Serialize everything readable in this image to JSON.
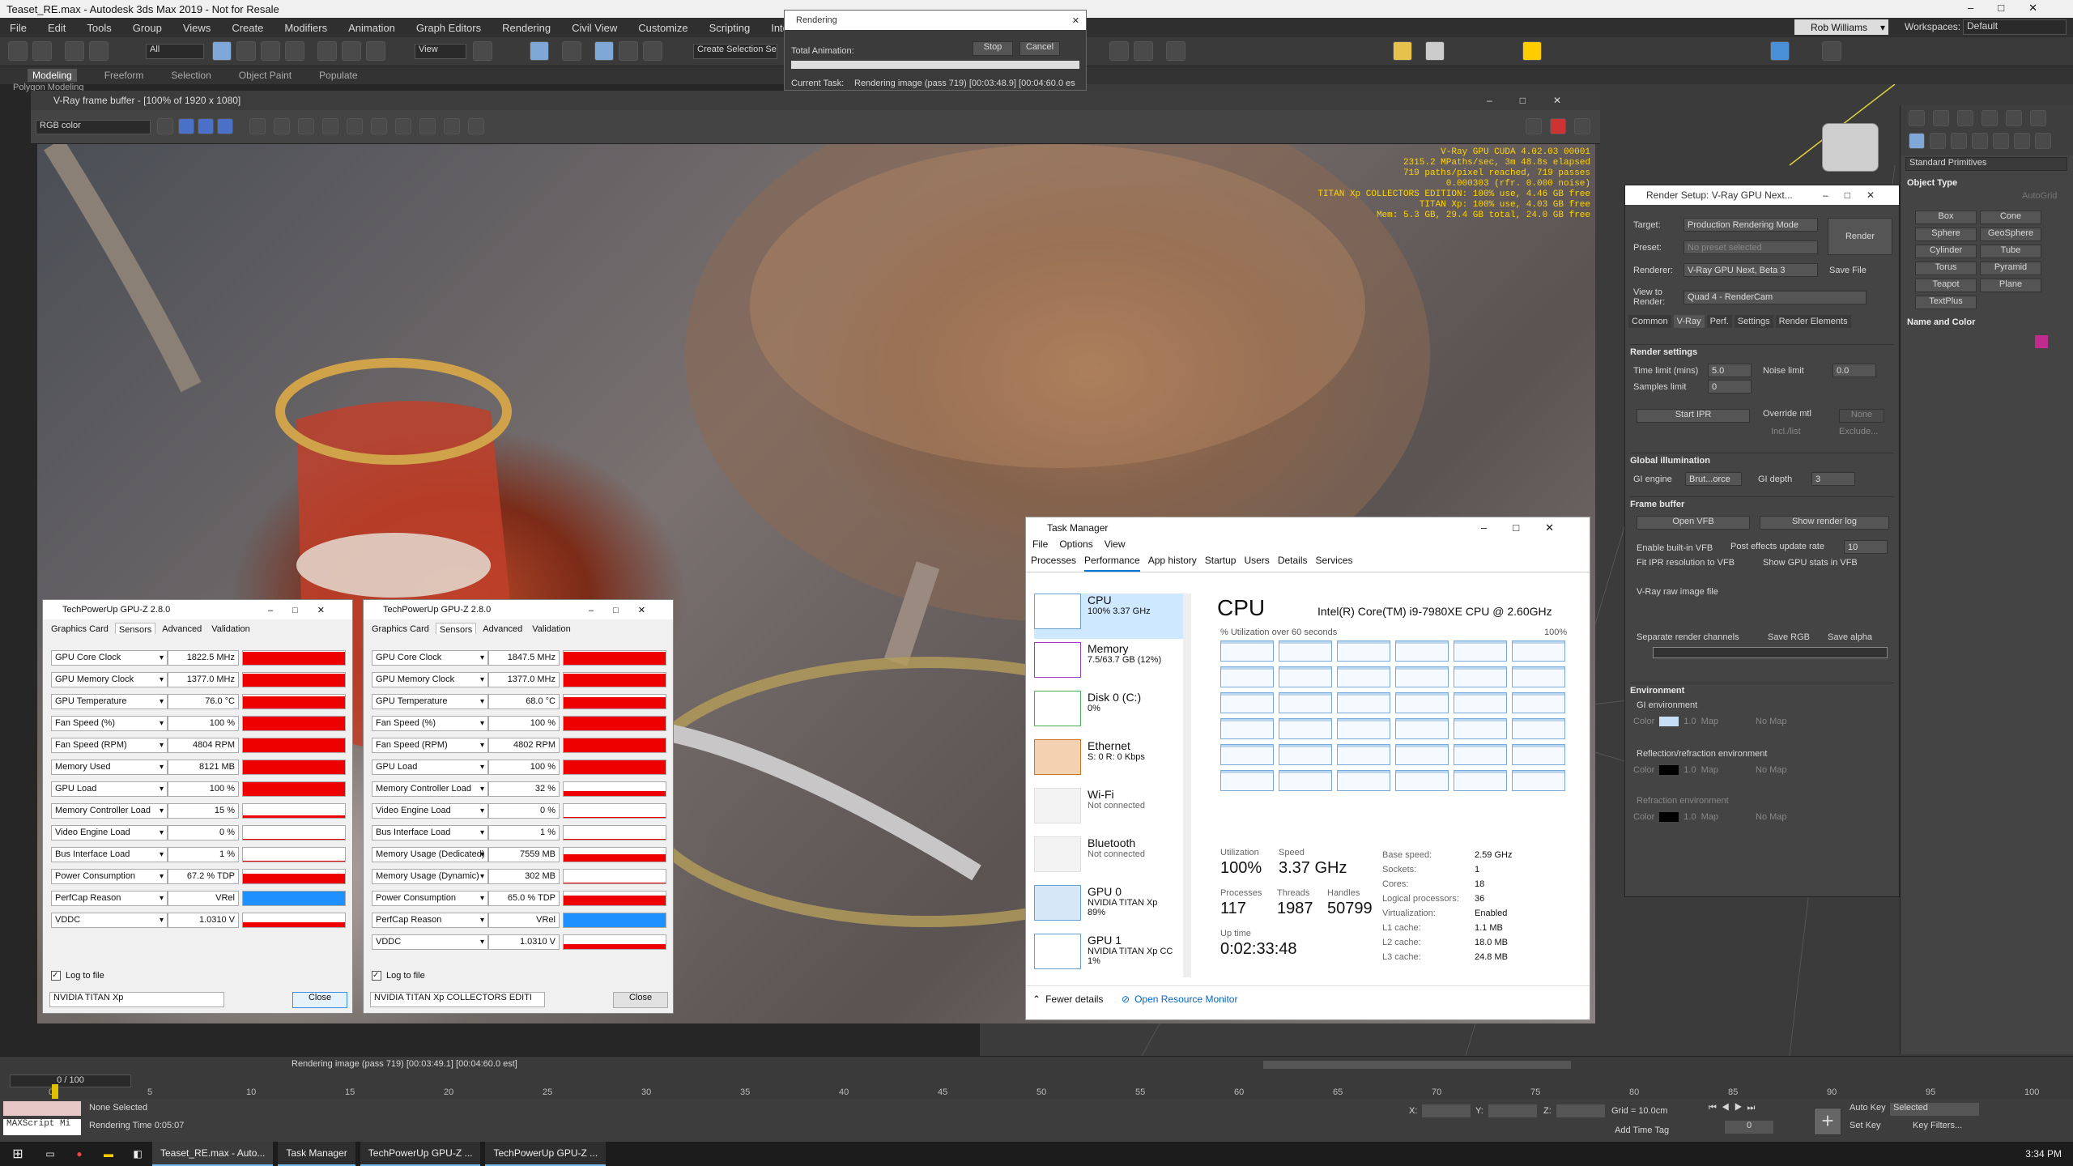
{
  "app": {
    "title": "Teaset_RE.max - Autodesk 3ds Max 2019 - Not for Resale",
    "user": "Rob Williams",
    "workspaces_label": "Workspaces:",
    "workspace": "Default"
  },
  "menu": [
    "File",
    "Edit",
    "Tools",
    "Group",
    "Views",
    "Create",
    "Modifiers",
    "Animation",
    "Graph Editors",
    "Rendering",
    "Civil View",
    "Customize",
    "Scripting",
    "Interactive"
  ],
  "toolbar": {
    "filter": "All",
    "view": "View",
    "selection_set": "Create Selection Se"
  },
  "ribbon": [
    "Modeling",
    "Freeform",
    "Selection",
    "Object Paint",
    "Populate"
  ],
  "ribbon_sub": "Polygon Modeling",
  "rendering_dialog": {
    "title": "Rendering",
    "stop": "Stop",
    "cancel": "Cancel",
    "total_label": "Total Animation:",
    "current_label": "Current Task:",
    "current_value": "Rendering image (pass 719) [00:03:48.9] [00:04:60.0 es"
  },
  "vfb": {
    "title": "V-Ray frame buffer - [100% of 1920 x 1080]",
    "channel": "RGB color",
    "stats": [
      "V-Ray GPU CUDA 4.02.03 00001",
      "2315.2 MPaths/sec, 3m 48.8s elapsed",
      "719 paths/pixel reached, 719 passes",
      "0.000303 (rfr. 0.000 noise)",
      "TITAN Xp COLLECTORS EDITION: 100% use, 4.46 GB free",
      "TITAN Xp: 100% use, 4.03 GB free",
      "Mem: 5.3 GB, 29.4 GB total, 24.0 GB free"
    ]
  },
  "render_setup": {
    "title": "Render Setup: V-Ray GPU Next...",
    "target_label": "Target:",
    "target": "Production Rendering Mode",
    "preset_label": "Preset:",
    "preset": "No preset selected",
    "renderer_label": "Renderer:",
    "renderer": "V-Ray GPU Next, Beta 3",
    "save_file": "Save File",
    "view_label": "View to Render:",
    "view": "Quad 4 - RenderCam",
    "render_btn": "Render",
    "tabs": [
      "Common",
      "V-Ray",
      "Perf.",
      "Settings",
      "Render Elements"
    ],
    "render_settings": "Render settings",
    "time_limit_label": "Time limit (mins)",
    "time_limit": "5.0",
    "noise_limit_label": "Noise limit",
    "noise_limit": "0.0",
    "samples_label": "Samples limit",
    "samples": "0",
    "start_ipr": "Start IPR",
    "override_mtl": "Override mtl",
    "none": "None",
    "incl_list": "Incl./list",
    "exclude": "Exclude...",
    "gi_section": "Global illumination",
    "gi_engine_label": "GI engine",
    "gi_engine": "Brut...orce",
    "gi_depth_label": "GI depth",
    "gi_depth": "3",
    "fb_section": "Frame buffer",
    "open_vfb": "Open VFB",
    "show_log": "Show render log",
    "enable_vfb": "Enable built-in VFB",
    "post_rate_label": "Post effects update rate",
    "post_rate": "10",
    "fit_ipr": "Fit IPR resolution to VFB",
    "gpu_stats": "Show GPU stats in VFB",
    "raw_file": "V-Ray raw image file",
    "sep_channels": "Separate render channels",
    "save_rgb": "Save RGB",
    "save_alpha": "Save alpha",
    "env_section": "Environment",
    "gi_env": "GI environment",
    "color": "Color",
    "env_val": "1.0",
    "map": "Map",
    "no_map": "No Map",
    "refl_env": "Reflection/refraction environment",
    "refr_env": "Refraction environment"
  },
  "command_panel": {
    "category": "Standard Primitives",
    "object_type": "Object Type",
    "autogrid": "AutoGrid",
    "buttons": [
      "Box",
      "Cone",
      "Sphere",
      "GeoSphere",
      "Cylinder",
      "Tube",
      "Torus",
      "Pyramid",
      "Teapot",
      "Plane",
      "TextPlus"
    ],
    "name_color": "Name and Color"
  },
  "task_manager": {
    "title": "Task Manager",
    "menu": [
      "File",
      "Options",
      "View"
    ],
    "tabs": [
      "Processes",
      "Performance",
      "App history",
      "Startup",
      "Users",
      "Details",
      "Services"
    ],
    "side": [
      {
        "name": "CPU",
        "sub": "100% 3.37 GHz"
      },
      {
        "name": "Memory",
        "sub": "7.5/63.7 GB (12%)"
      },
      {
        "name": "Disk 0 (C:)",
        "sub": "0%"
      },
      {
        "name": "Ethernet",
        "sub": "S: 0 R: 0 Kbps"
      },
      {
        "name": "Wi-Fi",
        "sub": "Not connected"
      },
      {
        "name": "Bluetooth",
        "sub": "Not connected"
      },
      {
        "name": "GPU 0",
        "sub": "NVIDIA TITAN Xp",
        "sub2": "89%"
      },
      {
        "name": "GPU 1",
        "sub": "NVIDIA TITAN Xp CC",
        "sub2": "1%"
      }
    ],
    "cpu_header": "CPU",
    "cpu_model": "Intel(R) Core(TM) i9-7980XE CPU @ 2.60GHz",
    "util_label": "% Utilization over 60 seconds",
    "pct100": "100%",
    "stats": {
      "utilization_label": "Utilization",
      "utilization": "100%",
      "speed_label": "Speed",
      "speed": "3.37 GHz",
      "processes_label": "Processes",
      "processes": "117",
      "threads_label": "Threads",
      "threads": "1987",
      "handles_label": "Handles",
      "handles": "50799",
      "uptime_label": "Up time",
      "uptime": "0:02:33:48"
    },
    "specs": [
      [
        "Base speed:",
        "2.59 GHz"
      ],
      [
        "Sockets:",
        "1"
      ],
      [
        "Cores:",
        "18"
      ],
      [
        "Logical processors:",
        "36"
      ],
      [
        "Virtualization:",
        "Enabled"
      ],
      [
        "L1 cache:",
        "1.1 MB"
      ],
      [
        "L2 cache:",
        "18.0 MB"
      ],
      [
        "L3 cache:",
        "24.8 MB"
      ]
    ],
    "fewer": "Fewer details",
    "resmon": "Open Resource Monitor"
  },
  "gpuz1": {
    "title": "TechPowerUp GPU-Z 2.8.0",
    "tabs": [
      "Graphics Card",
      "Sensors",
      "Advanced",
      "Validation"
    ],
    "card": "NVIDIA TITAN Xp",
    "log": "Log to file",
    "close": "Close",
    "sensors": [
      {
        "label": "GPU Core Clock",
        "value": "1822.5 MHz",
        "fill": 0.9
      },
      {
        "label": "GPU Memory Clock",
        "value": "1377.0 MHz",
        "fill": 0.9
      },
      {
        "label": "GPU Temperature",
        "value": "76.0 °C",
        "fill": 0.85
      },
      {
        "label": "Fan Speed (%)",
        "value": "100 %",
        "fill": 1.0
      },
      {
        "label": "Fan Speed (RPM)",
        "value": "4804 RPM",
        "fill": 1.0
      },
      {
        "label": "Memory Used",
        "value": "8121 MB",
        "fill": 0.95
      },
      {
        "label": "GPU Load",
        "value": "100 %",
        "fill": 1.0
      },
      {
        "label": "Memory Controller Load",
        "value": "15 %",
        "fill": 0.15
      },
      {
        "label": "Video Engine Load",
        "value": "0 %",
        "fill": 0
      },
      {
        "label": "Bus Interface Load",
        "value": "1 %",
        "fill": 0.02
      },
      {
        "label": "Power Consumption",
        "value": "67.2 % TDP",
        "fill": 0.67
      },
      {
        "label": "PerfCap Reason",
        "value": "VRel",
        "fill": 1.0,
        "color": "#1e90ff"
      },
      {
        "label": "VDDC",
        "value": "1.0310 V",
        "fill": 0.3
      }
    ]
  },
  "gpuz2": {
    "title": "TechPowerUp GPU-Z 2.8.0",
    "tabs": [
      "Graphics Card",
      "Sensors",
      "Advanced",
      "Validation"
    ],
    "card": "NVIDIA TITAN Xp COLLECTORS EDITI",
    "log": "Log to file",
    "close": "Close",
    "sensors": [
      {
        "label": "GPU Core Clock",
        "value": "1847.5 MHz",
        "fill": 0.9
      },
      {
        "label": "GPU Memory Clock",
        "value": "1377.0 MHz",
        "fill": 0.9
      },
      {
        "label": "GPU Temperature",
        "value": "68.0 °C",
        "fill": 0.8
      },
      {
        "label": "Fan Speed (%)",
        "value": "100 %",
        "fill": 1.0
      },
      {
        "label": "Fan Speed (RPM)",
        "value": "4802 RPM",
        "fill": 1.0
      },
      {
        "label": "GPU Load",
        "value": "100 %",
        "fill": 1.0
      },
      {
        "label": "Memory Controller Load",
        "value": "32 %",
        "fill": 0.32
      },
      {
        "label": "Video Engine Load",
        "value": "0 %",
        "fill": 0
      },
      {
        "label": "Bus Interface Load",
        "value": "1 %",
        "fill": 0.02
      },
      {
        "label": "Memory Usage (Dedicated)",
        "value": "7559 MB",
        "fill": 0.5
      },
      {
        "label": "Memory Usage (Dynamic)",
        "value": "302 MB",
        "fill": 0.05
      },
      {
        "label": "Power Consumption",
        "value": "65.0 % TDP",
        "fill": 0.65
      },
      {
        "label": "PerfCap Reason",
        "value": "VRel",
        "fill": 1.0,
        "color": "#1e90ff"
      },
      {
        "label": "VDDC",
        "value": "1.0310 V",
        "fill": 0.3
      }
    ]
  },
  "timeline": {
    "frame": "0 / 100",
    "ticks": [
      "0",
      "5",
      "10",
      "15",
      "20",
      "25",
      "30",
      "35",
      "40",
      "45",
      "50",
      "55",
      "60",
      "65",
      "70",
      "75",
      "80",
      "85",
      "90",
      "95",
      "100"
    ],
    "status": "Rendering image (pass 719) [00:03:49.1] [00:04:60.0 est]"
  },
  "status": {
    "selection": "None Selected",
    "render_time": "Rendering Time 0:05:07",
    "maxscript": "MAXScript Mi",
    "x": "X:",
    "y": "Y:",
    "z": "Z:",
    "grid": "Grid = 10.0cm",
    "add_time_tag": "Add Time Tag",
    "auto_key": "Auto Key",
    "set_key": "Set Key",
    "selected": "Selected",
    "key_filters": "Key Filters..."
  },
  "taskbar": {
    "tasks": [
      "Teaset_RE.max - Auto...",
      "Task Manager",
      "TechPowerUp GPU-Z ...",
      "TechPowerUp GPU-Z ..."
    ],
    "time": "3:34 PM"
  }
}
